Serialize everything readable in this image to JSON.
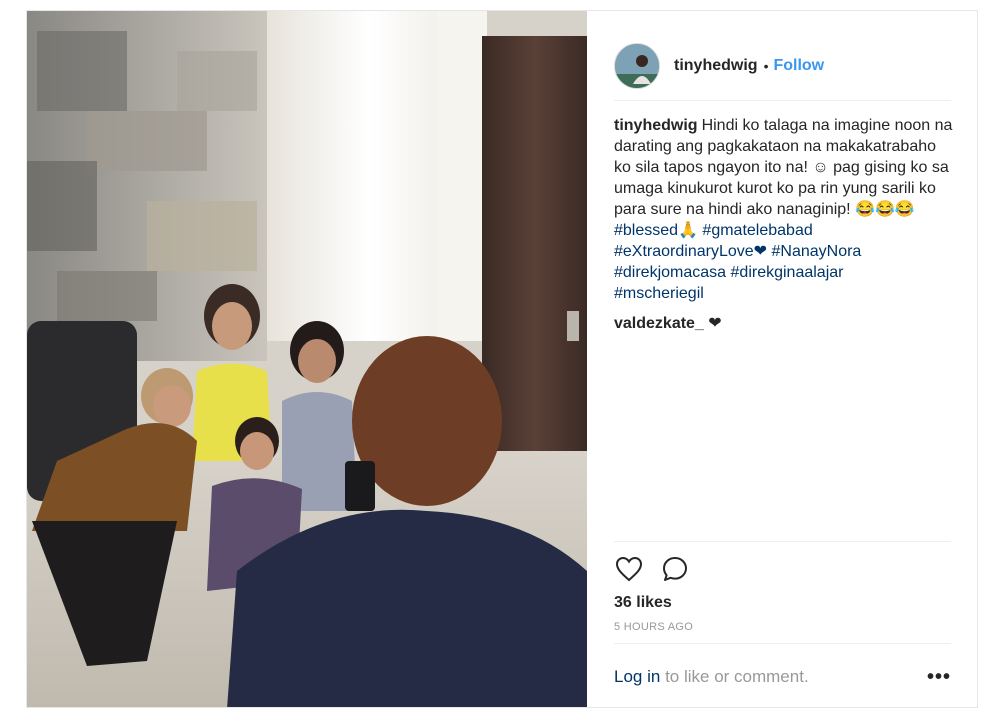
{
  "post": {
    "username": "tinyhedwig",
    "follow_label": "Follow",
    "separator": "•",
    "caption": {
      "username": "tinyhedwig",
      "text": "Hindi ko talaga na imagine noon na darating ang pagkakataon na makakatrabaho ko sila tapos ngayon ito na! ☺ pag gising ko sa umaga kinukurot kurot ko pa rin yung sarili ko para sure na hindi ako nanaginip! 😂😂😂",
      "hashtags": [
        "#blessed🙏",
        "#gmatelebabad",
        "#eXtraordinaryLove❤",
        "#NanayNora",
        "#direkjomacasa",
        "#direkginaalajar",
        "#mscheriegil"
      ]
    },
    "comments": [
      {
        "username": "valdezkate_",
        "text": "❤"
      }
    ],
    "likes_label": "36 likes",
    "timestamp": "5 HOURS AGO",
    "login_link": "Log in",
    "login_rest": "to like or comment.",
    "more_label": "•••",
    "icons": {
      "like": "heart-icon",
      "comment": "comment-icon",
      "more": "more-options-icon"
    }
  }
}
